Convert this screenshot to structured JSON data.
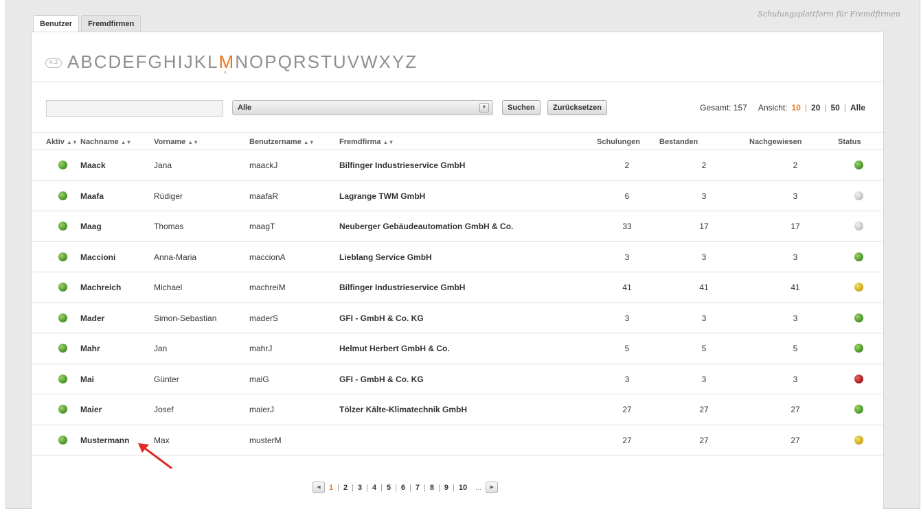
{
  "brand": "Schulungsplattform für Fremdfirmen",
  "tabs": [
    {
      "label": "Benutzer",
      "active": true
    },
    {
      "label": "Fremdfirmen",
      "active": false
    }
  ],
  "alphabet": {
    "icon_label": "A..Z",
    "letters": [
      "A",
      "B",
      "C",
      "D",
      "E",
      "F",
      "G",
      "H",
      "I",
      "J",
      "K",
      "L",
      "M",
      "N",
      "O",
      "P",
      "Q",
      "R",
      "S",
      "T",
      "U",
      "V",
      "W",
      "X",
      "Y",
      "Z"
    ],
    "active": "M",
    "caret": "^"
  },
  "filter": {
    "search_value": "",
    "select_value": "Alle",
    "search_button": "Suchen",
    "reset_button": "Zurücksetzen"
  },
  "totals": {
    "label": "Gesamt: 157",
    "view_label": "Ansicht:",
    "options": [
      "10",
      "20",
      "50",
      "Alle"
    ],
    "active": "10"
  },
  "table": {
    "headers": {
      "aktiv": "Aktiv",
      "nachname": "Nachname",
      "vorname": "Vorname",
      "benutzername": "Benutzername",
      "fremdfirma": "Fremdfirma",
      "schulungen": "Schulungen",
      "bestanden": "Bestanden",
      "nachgewiesen": "Nachgewiesen",
      "status": "Status"
    },
    "rows": [
      {
        "aktiv": "green",
        "nachname": "Maack",
        "vorname": "Jana",
        "benutzername": "maackJ",
        "fremdfirma": "Bilfinger Industrieservice GmbH",
        "schulungen": "2",
        "bestanden": "2",
        "nachgewiesen": "2",
        "status": "green"
      },
      {
        "aktiv": "green",
        "nachname": "Maafa",
        "vorname": "Rüdiger",
        "benutzername": "maafaR",
        "fremdfirma": "Lagrange TWM GmbH",
        "schulungen": "6",
        "bestanden": "3",
        "nachgewiesen": "3",
        "status": "grey"
      },
      {
        "aktiv": "green",
        "nachname": "Maag",
        "vorname": "Thomas",
        "benutzername": "maagT",
        "fremdfirma": "Neuberger Gebäudeautomation GmbH & Co.",
        "schulungen": "33",
        "bestanden": "17",
        "nachgewiesen": "17",
        "status": "grey"
      },
      {
        "aktiv": "green",
        "nachname": "Maccioni",
        "vorname": "Anna-Maria",
        "benutzername": "maccionA",
        "fremdfirma": "Lieblang Service GmbH",
        "schulungen": "3",
        "bestanden": "3",
        "nachgewiesen": "3",
        "status": "green"
      },
      {
        "aktiv": "green",
        "nachname": "Machreich",
        "vorname": "Michael",
        "benutzername": "machreiM",
        "fremdfirma": "Bilfinger Industrieservice GmbH",
        "schulungen": "41",
        "bestanden": "41",
        "nachgewiesen": "41",
        "status": "yellow"
      },
      {
        "aktiv": "green",
        "nachname": "Mader",
        "vorname": "Simon-Sebastian",
        "benutzername": "maderS",
        "fremdfirma": "GFI - GmbH & Co. KG",
        "schulungen": "3",
        "bestanden": "3",
        "nachgewiesen": "3",
        "status": "green"
      },
      {
        "aktiv": "green",
        "nachname": "Mahr",
        "vorname": "Jan",
        "benutzername": "mahrJ",
        "fremdfirma": "Helmut Herbert GmbH & Co.",
        "schulungen": "5",
        "bestanden": "5",
        "nachgewiesen": "5",
        "status": "green"
      },
      {
        "aktiv": "green",
        "nachname": "Mai",
        "vorname": "Günter",
        "benutzername": "maiG",
        "fremdfirma": "GFI - GmbH & Co. KG",
        "schulungen": "3",
        "bestanden": "3",
        "nachgewiesen": "3",
        "status": "red"
      },
      {
        "aktiv": "green",
        "nachname": "Maier",
        "vorname": "Josef",
        "benutzername": "maierJ",
        "fremdfirma": "Tölzer Kälte-Klimatechnik GmbH",
        "schulungen": "27",
        "bestanden": "27",
        "nachgewiesen": "27",
        "status": "green"
      },
      {
        "aktiv": "green",
        "nachname": "Mustermann",
        "vorname": "Max",
        "benutzername": "musterM",
        "fremdfirma": "",
        "schulungen": "27",
        "bestanden": "27",
        "nachgewiesen": "27",
        "status": "yellow"
      }
    ]
  },
  "pagination": {
    "pages": [
      "1",
      "2",
      "3",
      "4",
      "5",
      "6",
      "7",
      "8",
      "9",
      "10"
    ],
    "active": "1",
    "ellipsis": "...",
    "prev_icon": "chevron-left-icon",
    "next_icon": "chevron-right-icon"
  },
  "annotation": {
    "icon": "red-arrow-icon",
    "color": "#e02a24"
  },
  "colors": {
    "accent": "#e8741e",
    "status_green": "#4f9a2c",
    "status_grey": "#c8c8c8",
    "status_yellow": "#cfae1b",
    "status_red": "#aa1f22"
  }
}
